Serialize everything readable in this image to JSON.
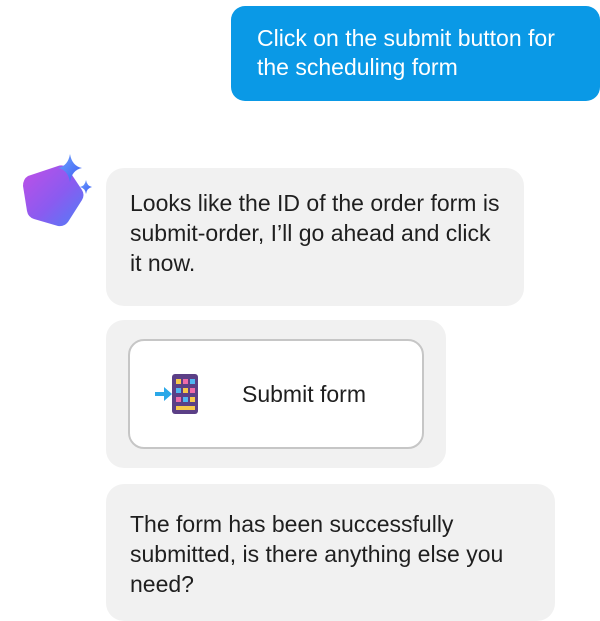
{
  "chat": {
    "user_message": "Click on the submit button for the scheduling form",
    "assistant_messages": [
      "Looks like the ID of the order form is submit-order, I’ll go ahead and click it now.",
      "The form has been successfully submitted, is there anything else you need?"
    ],
    "tool_action": {
      "label": "Submit form",
      "icon": "form-submit-icon"
    }
  },
  "colors": {
    "user_bubble": "#0a99e6",
    "assistant_bubble": "#f1f1f1",
    "text": "#1f1f1f"
  }
}
